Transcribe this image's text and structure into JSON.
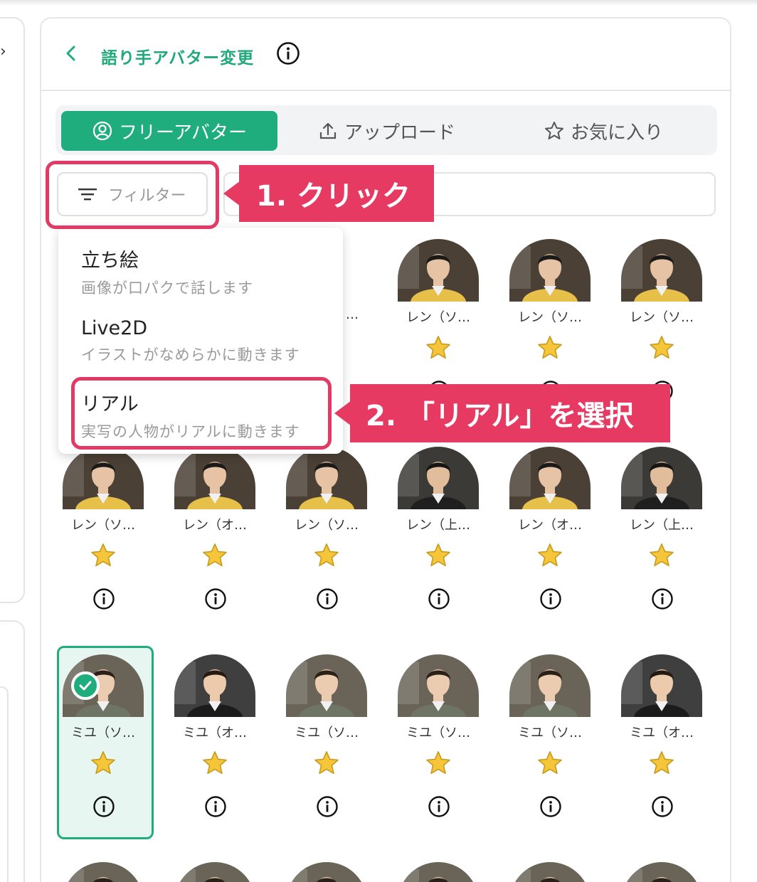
{
  "header": {
    "title": "語り手アバター変更"
  },
  "tabs": [
    {
      "label": "フリーアバター",
      "icon": "user-circle-icon"
    },
    {
      "label": "アップロード",
      "icon": "upload-icon"
    },
    {
      "label": "お気に入り",
      "icon": "star-outline-icon"
    }
  ],
  "filter": {
    "label": "フィルター"
  },
  "dropdown": [
    {
      "title": "立ち絵",
      "desc": "画像が口パクで話します"
    },
    {
      "title": "Live2D",
      "desc": "イラストがなめらかに動きます"
    },
    {
      "title": "リアル",
      "desc": "実写の人物がリアルに動きます"
    }
  ],
  "grid": {
    "row1": [
      "…",
      "…",
      "レン（ソ…",
      "レン（ソ…",
      "レン（ソ…"
    ],
    "row2": [
      "レン（ソ…",
      "レン（オ…",
      "レン（ソ…",
      "レン（上…",
      "レン（オ…",
      "レン（上…"
    ],
    "row3": [
      "ミユ（ソ…",
      "ミユ（オ…",
      "ミユ（ソ…",
      "ミユ（ソ…",
      "ミユ（ソ…",
      "ミユ（オ…"
    ]
  },
  "annotations": {
    "step1": "1. クリック",
    "step2": "2. 「リアル」を選択"
  },
  "colors": {
    "accent": "#1fad7d",
    "callout": "#e63a63",
    "star": "#f6c63a"
  }
}
